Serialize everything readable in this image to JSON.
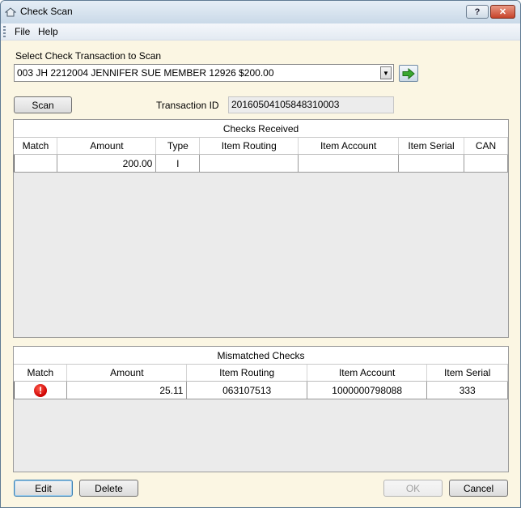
{
  "window": {
    "title": "Check Scan",
    "help_label": "?",
    "close_label": "✕"
  },
  "menu": {
    "file": "File",
    "help": "Help"
  },
  "select": {
    "label": "Select Check Transaction to Scan",
    "value": "003 JH 2212004 JENNIFER SUE MEMBER 12926 $200.00"
  },
  "scan": {
    "button_label": "Scan",
    "transaction_id_label": "Transaction ID",
    "transaction_id": "20160504105848310003"
  },
  "checks_received": {
    "title": "Checks Received",
    "columns": [
      "Match",
      "Amount",
      "Type",
      "Item Routing",
      "Item Account",
      "Item Serial",
      "CAN"
    ],
    "rows": [
      {
        "match": "",
        "amount": "200.00",
        "type": "I",
        "routing": "",
        "account": "",
        "serial": "",
        "can": ""
      }
    ]
  },
  "mismatched_checks": {
    "title": "Mismatched Checks",
    "columns": [
      "Match",
      "Amount",
      "Item Routing",
      "Item Account",
      "Item Serial"
    ],
    "rows": [
      {
        "match_icon": "error-icon",
        "amount": "25.11",
        "routing": "063107513",
        "account": "1000000798088",
        "serial": "333"
      }
    ]
  },
  "buttons": {
    "edit": "Edit",
    "delete": "Delete",
    "ok": "OK",
    "cancel": "Cancel"
  },
  "colors": {
    "window_bg": "#fbf6e3",
    "error": "#cc0000",
    "go_arrow": "#3aa830"
  }
}
